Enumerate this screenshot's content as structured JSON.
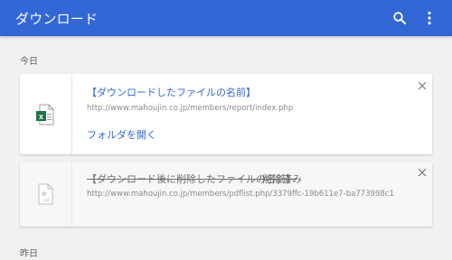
{
  "appbar": {
    "title": "ダウンロード",
    "search_icon": "search-icon",
    "more_icon": "more-vert-icon",
    "color": "#3367d6"
  },
  "sections": {
    "today": "今日",
    "yesterday": "昨日"
  },
  "downloads": [
    {
      "file_name": "【ダウンロードしたファイルの名前】",
      "url": "http://www.mahoujin.co.jp/members/report/index.php",
      "action": "フォルダを開く",
      "icon": "excel-file-icon"
    },
    {
      "file_name": "【ダウンロード後に削除したファイルの名前】",
      "status": "削除済み",
      "url": "http://www.mahoujin.co.jp/members/pdflist.php/3379ffc-19b611e7-ba773998c1....",
      "icon": "pdf-file-icon"
    }
  ]
}
